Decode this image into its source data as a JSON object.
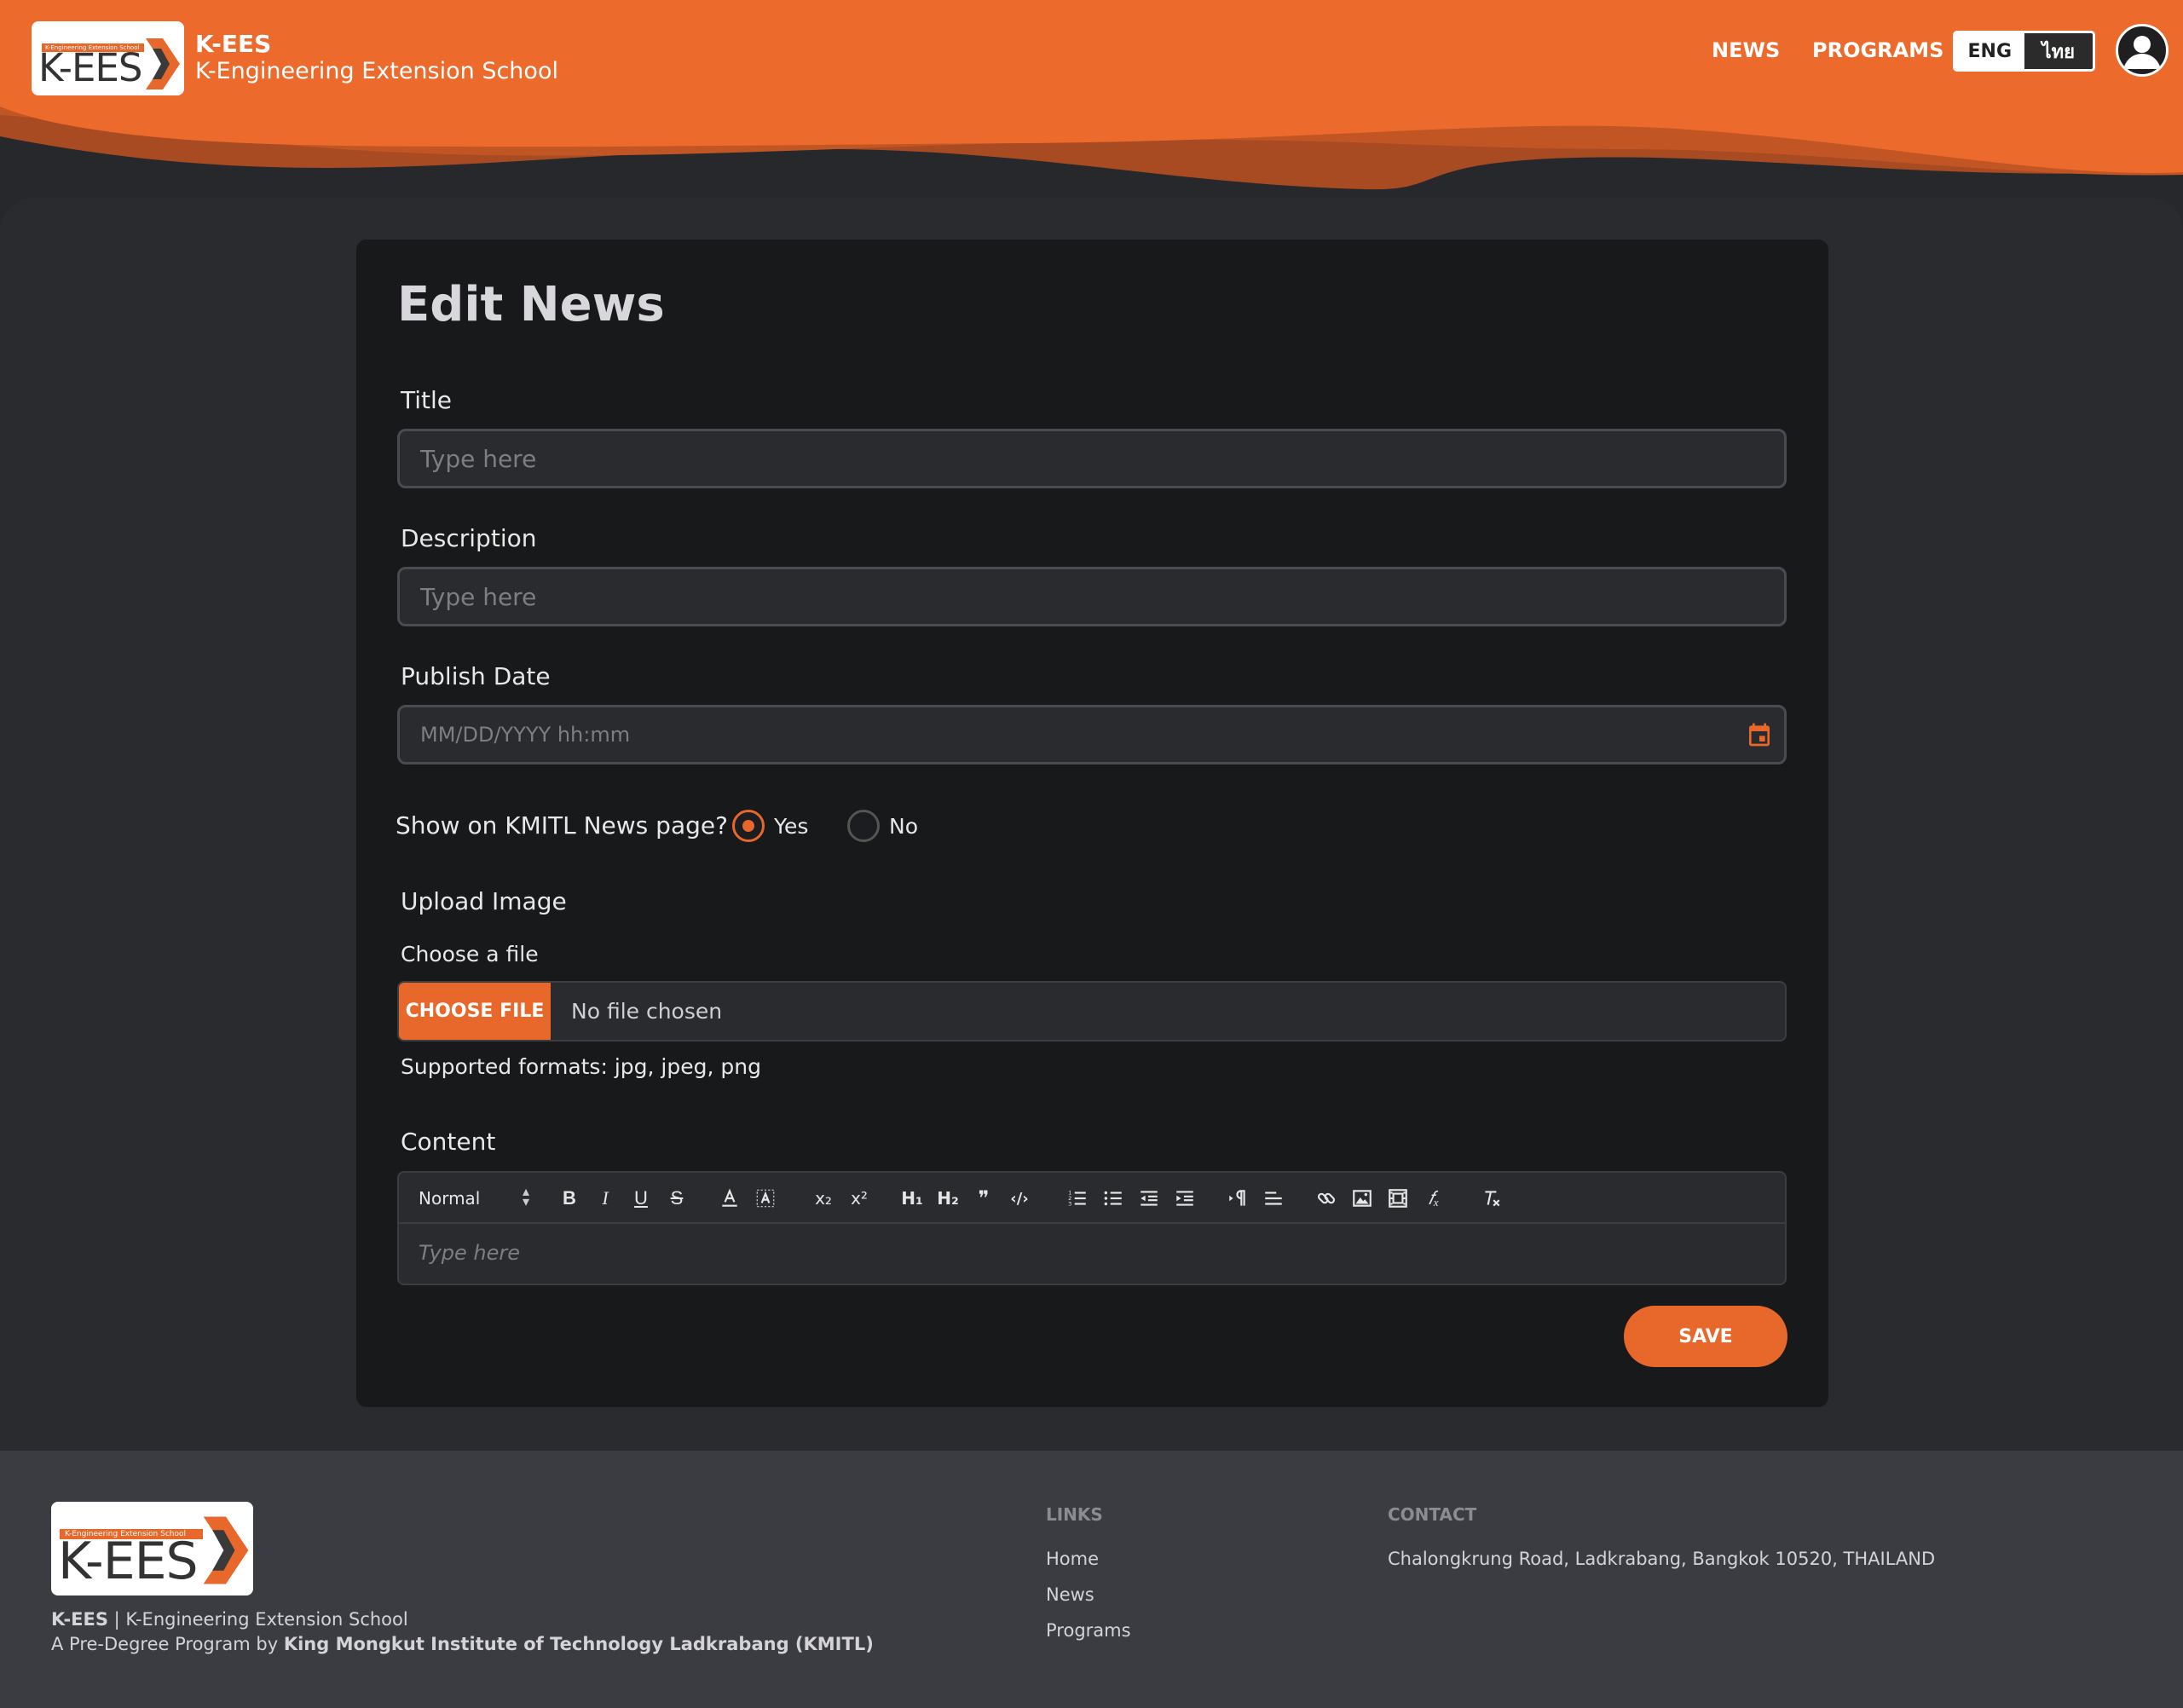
{
  "header": {
    "logo": {
      "strip_text": "K-Engineering Extension School",
      "text": "K-EES"
    },
    "brand_title": "K-EES",
    "brand_subtitle": "K-Engineering Extension School",
    "nav": {
      "news": "NEWS",
      "programs": "PROGRAMS"
    },
    "language": {
      "eng": "ENG",
      "thai": "ไทย",
      "selected": "ENG"
    },
    "brand_color": "#e8672a"
  },
  "form": {
    "title": "Edit News",
    "title_field": {
      "label": "Title",
      "value": "",
      "placeholder": "Type here"
    },
    "description_field": {
      "label": "Description",
      "value": "",
      "placeholder": "Type here"
    },
    "publish_date_field": {
      "label": "Publish Date",
      "value": "",
      "placeholder": "MM/DD/YYYY hh:mm",
      "icon": "calendar-icon"
    },
    "show_on_kmitl": {
      "question": "Show on KMITL News page?",
      "options": [
        {
          "label": "Yes",
          "checked": true
        },
        {
          "label": "No",
          "checked": false
        }
      ]
    },
    "upload": {
      "label": "Upload Image",
      "choose_label": "Choose a file",
      "button": "CHOOSE FILE",
      "status": "No file chosen",
      "formats": "Supported formats: jpg, jpeg, png"
    },
    "content": {
      "label": "Content",
      "format_select": "Normal",
      "placeholder": "Type here",
      "toolbar": {
        "bold": "B",
        "italic": "I",
        "underline": "U",
        "strike": "S",
        "subscript": "x₂",
        "superscript": "x²",
        "h1": "H₁",
        "h2": "H₂",
        "blockquote": "❞",
        "code": "‹/›",
        "formula": "𝑓ₓ"
      }
    },
    "save_button": "SAVE"
  },
  "footer": {
    "logo": {
      "strip_text": "K-Engineering Extension School",
      "text": "K-EES"
    },
    "line1_bold": "K-EES",
    "line1_rest": " | K-Engineering Extension School",
    "line2_prefix": "A Pre-Degree Program by ",
    "line2_bold": "King Mongkut Institute of Technology Ladkrabang (KMITL)",
    "links_heading": "LINKS",
    "links": [
      "Home",
      "News",
      "Programs"
    ],
    "contact_heading": "CONTACT",
    "address": "Chalongkrung Road, Ladkrabang, Bangkok 10520, THAILAND"
  }
}
